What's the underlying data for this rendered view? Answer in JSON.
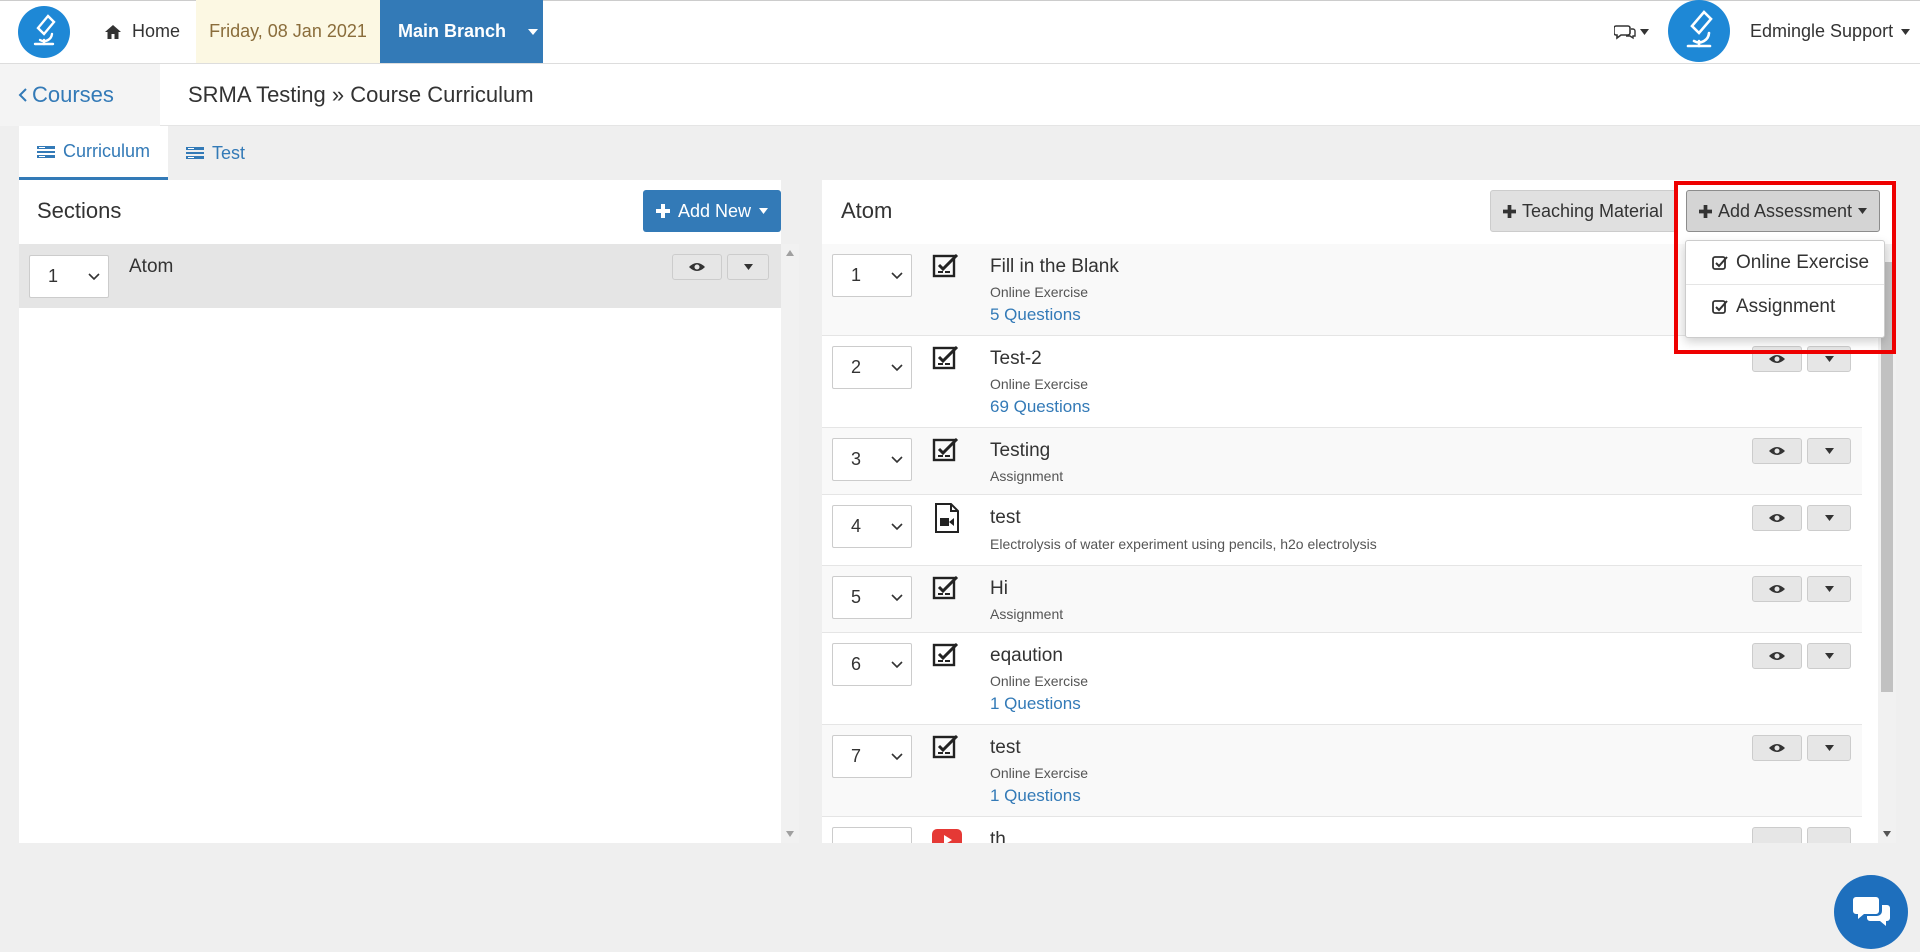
{
  "topbar": {
    "home_label": "Home",
    "date": "Friday, 08 Jan 2021",
    "branch": "Main Branch",
    "user_name": "Edmingle Support"
  },
  "breadcrumb": {
    "back_label": "Courses",
    "title": "SRMA Testing » Course Curriculum"
  },
  "tabs": [
    {
      "label": "Curriculum",
      "active": true
    },
    {
      "label": "Test",
      "active": false
    }
  ],
  "sections_panel": {
    "title": "Sections",
    "add_new_label": "Add New",
    "sections": [
      {
        "order": "1",
        "name": "Atom"
      }
    ]
  },
  "content_panel": {
    "title": "Atom",
    "teaching_material_label": "Teaching Material",
    "add_assessment_label": "Add Assessment",
    "dropdown": [
      {
        "label": "Online Exercise"
      },
      {
        "label": "Assignment"
      }
    ],
    "items": [
      {
        "order": "1",
        "icon": "checklist-icon",
        "title": "Fill in the Blank",
        "type": "Online Exercise",
        "questions": "5 Questions"
      },
      {
        "order": "2",
        "icon": "checklist-icon",
        "title": "Test-2",
        "type": "Online Exercise",
        "questions": "69 Questions"
      },
      {
        "order": "3",
        "icon": "checklist-icon",
        "title": "Testing",
        "type": "Assignment",
        "questions": ""
      },
      {
        "order": "4",
        "icon": "video-file-icon",
        "title": "test",
        "type": "Electrolysis of water experiment using pencils, h2o electrolysis",
        "questions": ""
      },
      {
        "order": "5",
        "icon": "checklist-icon",
        "title": "Hi",
        "type": "Assignment",
        "questions": ""
      },
      {
        "order": "6",
        "icon": "checklist-icon",
        "title": "eqaution",
        "type": "Online Exercise",
        "questions": "1 Questions"
      },
      {
        "order": "7",
        "icon": "checklist-icon",
        "title": "test",
        "type": "Online Exercise",
        "questions": "1 Questions"
      },
      {
        "order": "",
        "icon": "youtube-icon",
        "title": "th",
        "type": "",
        "questions": ""
      }
    ]
  },
  "colors": {
    "primary": "#337ab7",
    "date_bg": "#fcf8e3",
    "highlight": "#ee0000"
  }
}
